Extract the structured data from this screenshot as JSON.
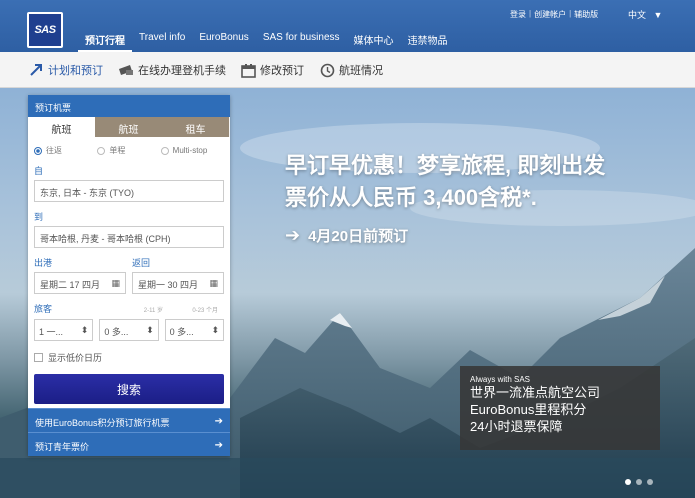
{
  "brand": {
    "logo_text": "SAS"
  },
  "header": {
    "nav": [
      "预订行程",
      "Travel info",
      "EuroBonus",
      "SAS for business",
      "媒体中心",
      "违禁物品"
    ],
    "toplinks": [
      "登录",
      "创建帐户",
      "辅助版"
    ],
    "language": "中文",
    "language_icon": "caret-down-icon"
  },
  "subnav": [
    {
      "label": "计划和预订",
      "icon": "plane-pointer-icon"
    },
    {
      "label": "在线办理登机手续",
      "icon": "ticket-icon"
    },
    {
      "label": "修改预订",
      "icon": "calendar-icon"
    },
    {
      "label": "航班情况",
      "icon": "clock-icon"
    }
  ],
  "hero": {
    "headline_line1": "早订早优惠！梦享旅程, 即刻出发",
    "headline_line2": "票价从人民币 3,400含税*.",
    "cta": "4月20日前预订"
  },
  "promo": {
    "small": "Always with SAS",
    "line1": "世界一流准点航空公司",
    "line2": "EuroBonus里程积分",
    "line3": "24小时退票保障"
  },
  "booking": {
    "title": "预订机票",
    "tabs": [
      "航班",
      "航班",
      "租车"
    ],
    "trip_types": [
      "往返",
      "单程",
      "Multi-stop"
    ],
    "from_label": "自",
    "from_value": "东京, 日本 - 东京 (TYO)",
    "to_label": "到",
    "to_value": "哥本哈根, 丹麦 - 哥本哈根 (CPH)",
    "depart_label": "出港",
    "depart_value": "星期二 17 四月",
    "return_label": "返回",
    "return_value": "星期一 30 四月",
    "passengers_label": "旅客",
    "age_child": "2-11 岁",
    "age_infant": "0-23 个月",
    "adults": "1 一...",
    "children": "0 多...",
    "infants": "0 多...",
    "low_fare_label": "显示低价日历",
    "search_label": "搜索",
    "links": [
      "使用EuroBonus积分预订旅行机票",
      "预订青年票价"
    ]
  },
  "colors": {
    "brand_blue": "#2e6db8",
    "search_navy": "#1f2396",
    "tab_brown": "#988a77"
  }
}
